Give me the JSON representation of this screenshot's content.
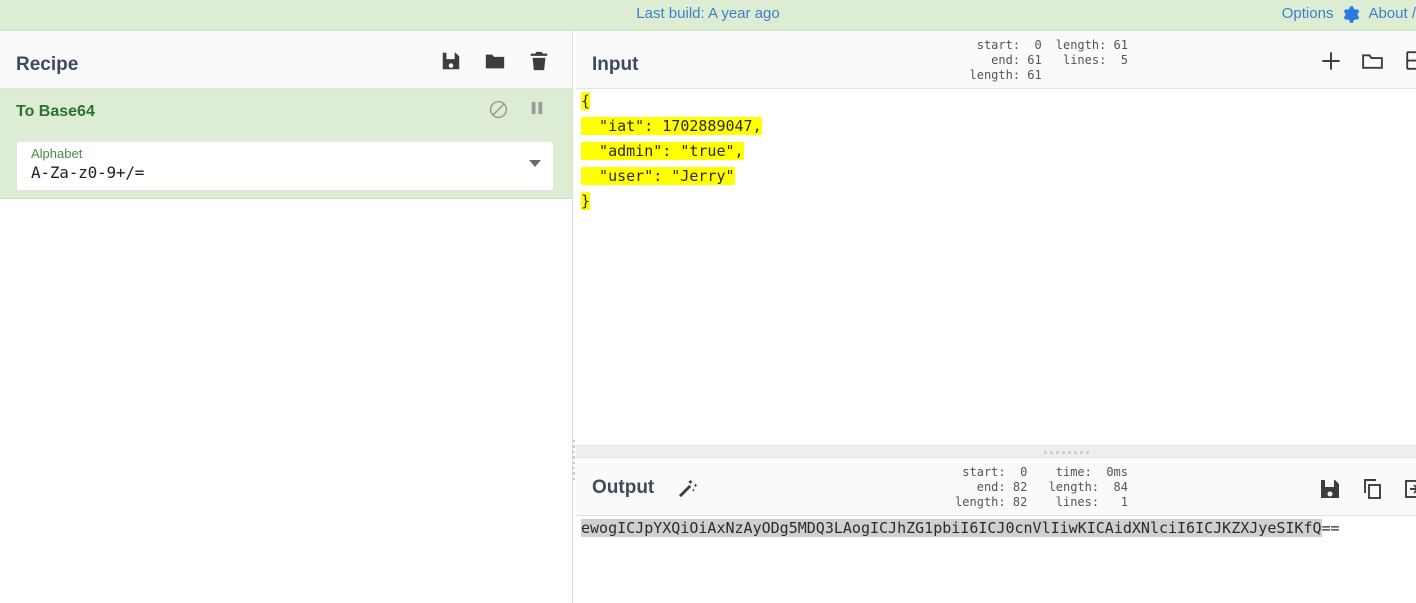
{
  "banner": {
    "last_build": "Last build: A year ago",
    "options_label": "Options",
    "about_label": "About /",
    "link_color": "#3e7ecb",
    "background": "#dcedd4"
  },
  "recipe": {
    "title": "Recipe",
    "icons": [
      "save-icon",
      "folder-icon",
      "trash-icon"
    ],
    "operation": {
      "name": "To Base64",
      "name_color": "#2e7031",
      "background": "#dcedd4",
      "icons": [
        "disable-icon",
        "pause-icon"
      ],
      "argument": {
        "label": "Alphabet",
        "value": "A-Za-z0-9+/="
      }
    }
  },
  "input": {
    "title": "Input",
    "meta_left": [
      "start:  0",
      "  end: 61",
      "length: 61"
    ],
    "meta_right": [
      "length: 61",
      " lines:  5"
    ],
    "icons": [
      "add-tab-icon",
      "open-folder-icon",
      "clear-io-icon"
    ],
    "lines": [
      {
        "text": "{",
        "highlight": true
      },
      {
        "text": "  \"iat\": 1702889047,",
        "highlight": true
      },
      {
        "text": "  \"admin\": \"true\",",
        "highlight": true
      },
      {
        "text": "  \"user\": \"Jerry\"",
        "highlight": true
      },
      {
        "text": "}",
        "highlight": true
      }
    ],
    "selection_color": "#ffff00"
  },
  "output": {
    "title": "Output",
    "magic_icon": "magic-wand-icon",
    "meta_left": [
      "start:  0",
      "  end: 82",
      "length: 82"
    ],
    "meta_right": [
      "  time:  0ms",
      "length:  84",
      " lines:   1"
    ],
    "icons": [
      "save-icon",
      "copy-icon",
      "replace-input-icon"
    ],
    "text_selected": "ewogICJpYXQiOiAxNzAyODg5MDQ3LAogICJhZG1pbiI6ICJ0cnVlIiwKICAidXNlciI6ICJKZXJyeSIKfQ",
    "text_tail": "==",
    "selection_color": "#d0d0d0"
  }
}
